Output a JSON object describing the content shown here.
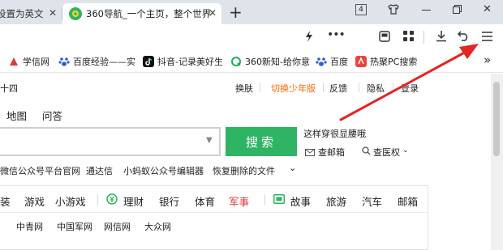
{
  "tabs": [
    {
      "label": "设置为英文"
    },
    {
      "label": "360导航_一个主页，整个世界"
    }
  ],
  "new_tab": "+",
  "window": {
    "tab_count": "4"
  },
  "bookmarks": [
    {
      "label": "学信网"
    },
    {
      "label": "百度经验——实"
    },
    {
      "label": "抖音-记录美好生"
    },
    {
      "label": "360新知-给你意"
    },
    {
      "label": "百度"
    },
    {
      "label": "热聚PC搜索"
    }
  ],
  "bookmarks_more": "»",
  "page": {
    "date_fragment": "十四",
    "top_links": {
      "skin": "换肤",
      "youth": "切换少年版",
      "feedback": "反馈",
      "privacy": "隐私",
      "account": "登录"
    },
    "search_tabs": [
      "地图",
      "问答"
    ],
    "search_button": "搜索",
    "hot_hint": "这样穿很显腰哦",
    "mail_link": "查邮箱",
    "rights_link": "查医权",
    "quick_links": [
      "微信公众号平台官网",
      "通达信",
      "小蚂蚁公众号编辑器",
      "恢复删除的文件"
    ],
    "nav_row1": [
      "装",
      "游戏",
      "小游戏",
      "理财",
      "银行",
      "体育",
      "军事",
      "故事",
      "旅游",
      "汽车",
      "邮箱"
    ],
    "nav_row2": [
      "中青网",
      "中国军网",
      "网信网",
      "大众网"
    ]
  },
  "colors": {
    "accent": "#ff6600",
    "search_green": "#2fb463",
    "arrow_red": "#e52424",
    "military_red": "#e03a3a"
  }
}
